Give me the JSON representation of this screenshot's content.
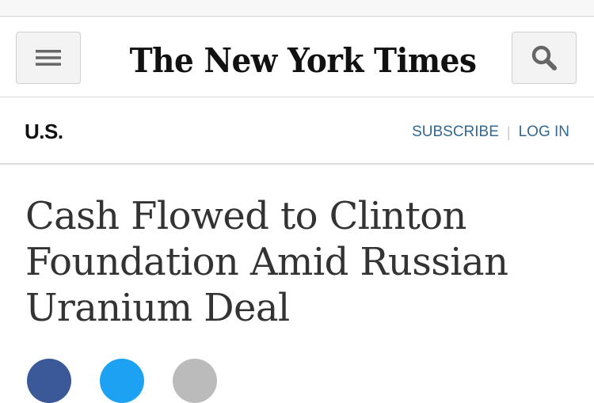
{
  "masthead": {
    "logo_text": "The New York Times",
    "menu_icon": "hamburger-menu-icon",
    "search_icon": "search-icon"
  },
  "section": {
    "name": "U.S.",
    "subscribe_label": "SUBSCRIBE",
    "separator": "|",
    "login_label": "LOG IN"
  },
  "article": {
    "headline": "Cash Flowed to Clinton Foundation Amid Russian Uranium Deal"
  },
  "share": {
    "icons": [
      "facebook-icon",
      "twitter-icon",
      "email-icon"
    ],
    "colors": [
      "#3b5998",
      "#1da1f2",
      "#bbbbbb"
    ]
  },
  "colors": {
    "link": "#326891",
    "headline": "#333333",
    "button_bg": "#f3f3f3"
  }
}
